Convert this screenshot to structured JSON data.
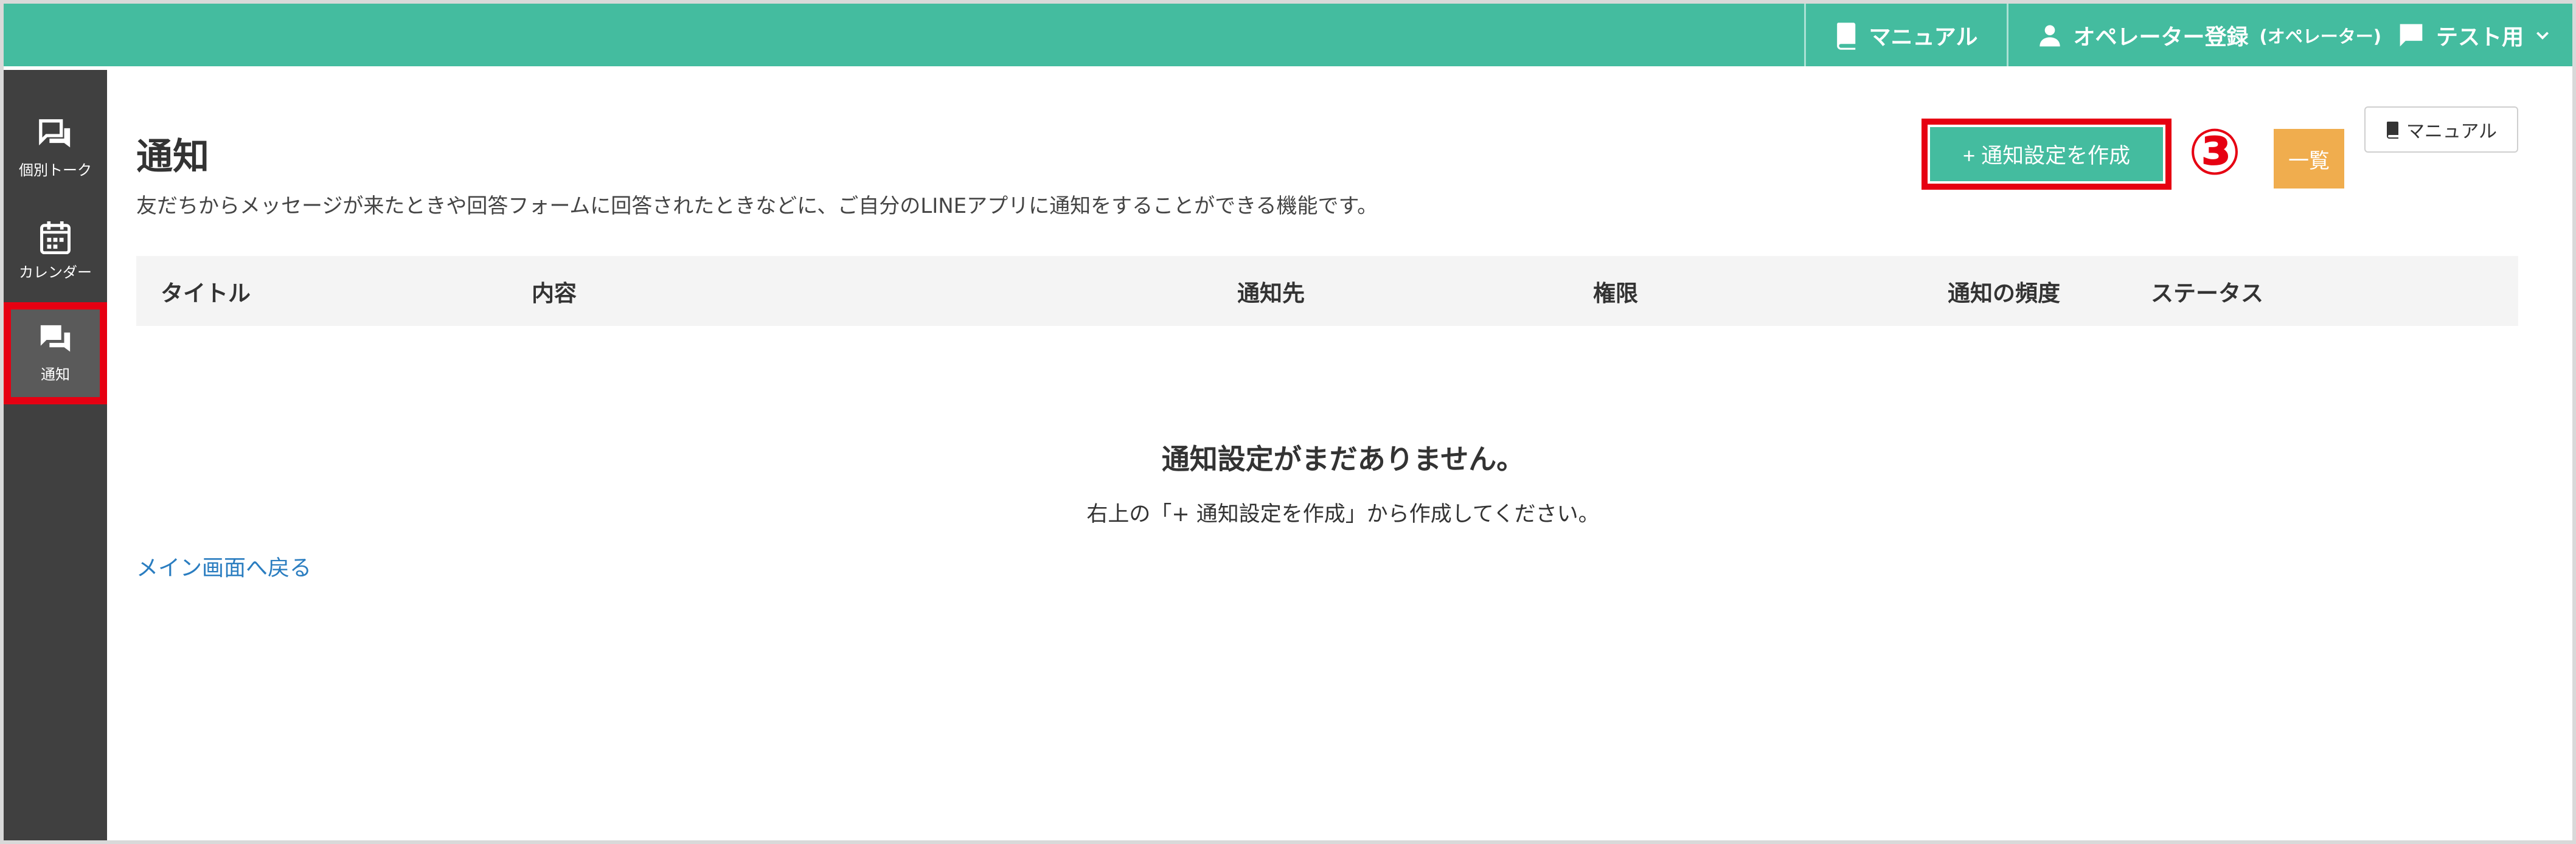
{
  "topbar": {
    "manual_label": "マニュアル",
    "operator_label": "オペレーター登録",
    "operator_role": "(オペレーター)",
    "account_label": "テスト用"
  },
  "sidebar": {
    "items": [
      {
        "label": "個別トーク",
        "icon": "chat-bubbles-icon"
      },
      {
        "label": "カレンダー",
        "icon": "calendar-icon"
      },
      {
        "label": "通知",
        "icon": "chat-bubbles-icon",
        "active": true
      }
    ]
  },
  "main": {
    "title": "通知",
    "description": "友だちからメッセージが来たときや回答フォームに回答されたときなどに、ご自分のLINEアプリに通知をすることができる機能です。",
    "create_button": "+ 通知設定を作成",
    "step_marker": "③",
    "list_button": "一覧",
    "manual_button": "マニュアル"
  },
  "table": {
    "columns": [
      "タイトル",
      "内容",
      "通知先",
      "権限",
      "通知の頻度",
      "ステータス"
    ]
  },
  "empty": {
    "title": "通知設定がまだありません。",
    "subtitle": "右上の「+ 通知設定を作成」から作成してください。"
  },
  "back_link": "メイン画面へ戻る",
  "colors": {
    "brand": "#44bc9f",
    "sidebar": "#404040",
    "highlight": "#e60012",
    "list_button": "#f0ad4e",
    "link": "#2a7dc0"
  }
}
